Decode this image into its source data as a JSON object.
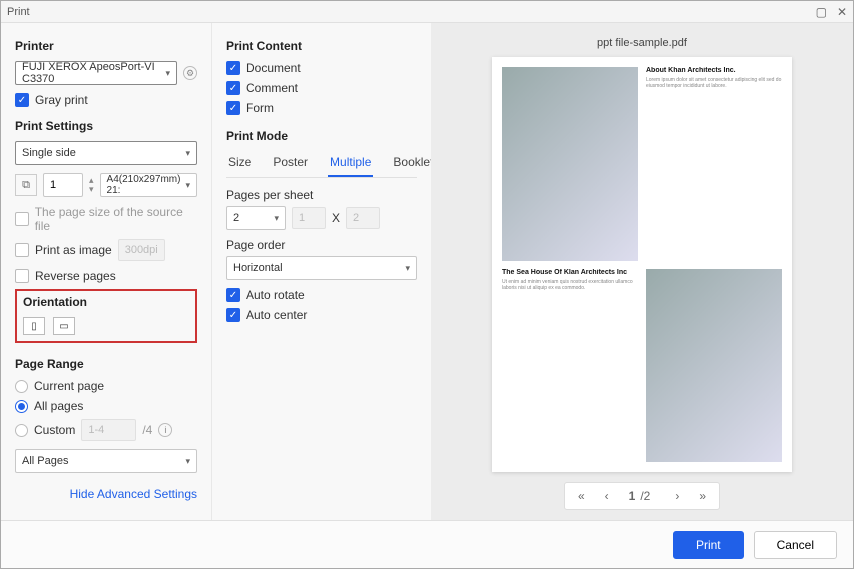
{
  "window": {
    "title": "Print"
  },
  "left": {
    "printer_h": "Printer",
    "printer_sel": "FUJI XEROX ApeosPort-VI C3370",
    "gray_print": "Gray print",
    "settings_h": "Print Settings",
    "side_sel": "Single side",
    "copies": "1",
    "paper_sel": "A4(210x297mm) 21:",
    "source_size": "The page size of the source file",
    "print_image": "Print as image",
    "dpi_ph": "300dpi",
    "reverse": "Reverse pages",
    "orient_h": "Orientation",
    "range_h": "Page Range",
    "current": "Current page",
    "all": "All pages",
    "custom": "Custom",
    "custom_ph": "1-4",
    "slash_total": "/4",
    "allpages_sel": "All Pages",
    "hide_adv": "Hide Advanced Settings"
  },
  "mid": {
    "content_h": "Print Content",
    "doc": "Document",
    "comment": "Comment",
    "form": "Form",
    "mode_h": "Print Mode",
    "tabs": {
      "size": "Size",
      "poster": "Poster",
      "multiple": "Multiple",
      "booklet": "Booklet"
    },
    "pps_h": "Pages per sheet",
    "pps_val": "2",
    "times": "X",
    "order_h": "Page order",
    "order_sel": "Horizontal",
    "auto_rotate": "Auto rotate",
    "auto_center": "Auto center"
  },
  "right": {
    "filename": "ppt file-sample.pdf",
    "page_cur": "1",
    "page_total": "/2"
  },
  "footer": {
    "print": "Print",
    "cancel": "Cancel"
  }
}
